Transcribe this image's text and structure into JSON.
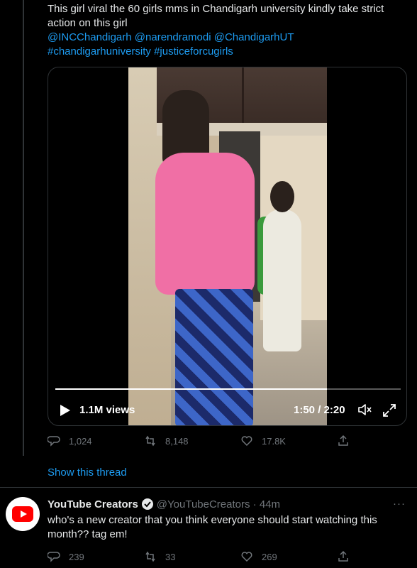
{
  "tweet1": {
    "text_line1": "This girl viral the 60 girls mms in Chandigarh university kindly take strict",
    "text_line2": "action on this girl",
    "mentions": "@INCChandigarh @narendramodi @ChandigarhUT",
    "hashtags": "#chandigarhuniversity #justiceforcugirls",
    "video": {
      "views": "1.1M views",
      "time": "1:50 / 2:20",
      "progress": 0.786
    },
    "actions": {
      "replies": "1,024",
      "retweets": "8,148",
      "likes": "17.8K"
    }
  },
  "show_thread": "Show this thread",
  "tweet2": {
    "author_name": "YouTube Creators",
    "handle_time": "@YouTubeCreators · 44m",
    "more": "···",
    "text": "who's a new creator that you think everyone should start watching this month?? tag em!",
    "actions": {
      "replies": "239",
      "retweets": "33",
      "likes": "269"
    }
  },
  "colors": {
    "accent": "#1d9bf0",
    "muted": "#71767b",
    "youtube": "#ff0000"
  },
  "icons": [
    "reply-icon",
    "retweet-icon",
    "like-icon",
    "share-icon",
    "play-icon",
    "volume-icon",
    "fullscreen-icon",
    "verified-badge-icon",
    "youtube-logo-icon"
  ]
}
